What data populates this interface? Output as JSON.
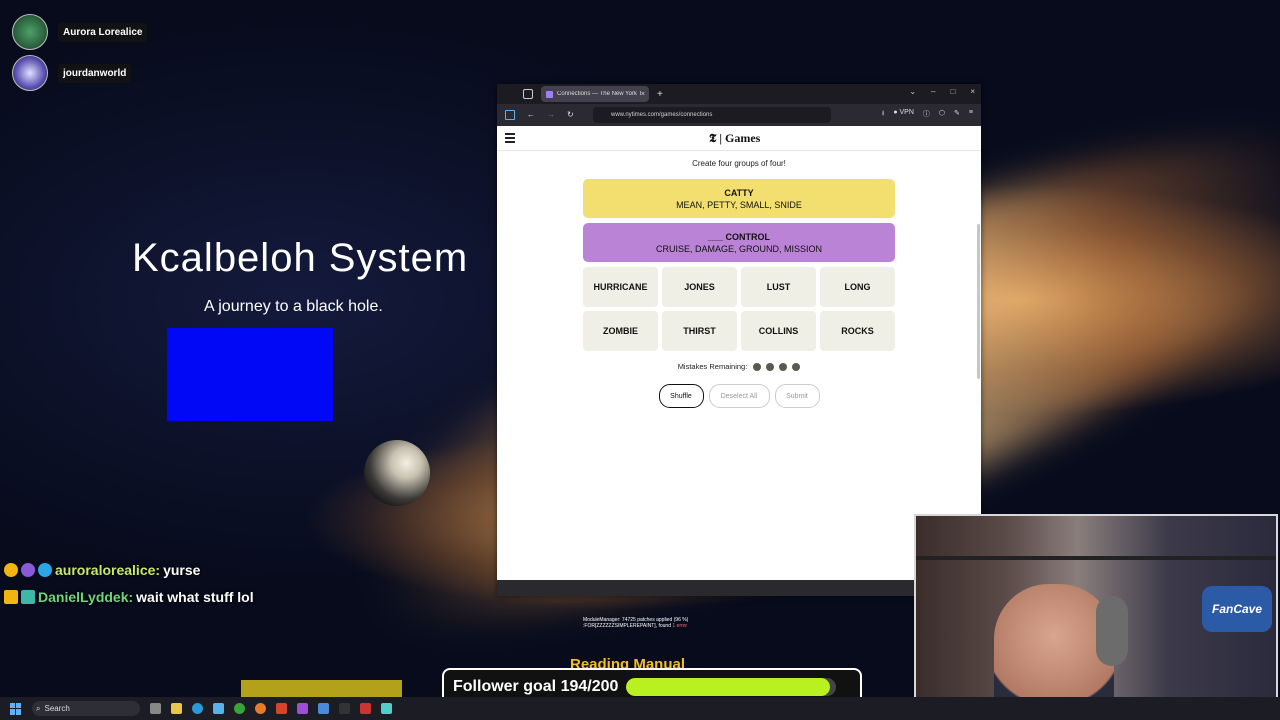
{
  "overlay": {
    "viewers": [
      {
        "name": "Aurora Lorealice",
        "color": "#2f7a48"
      },
      {
        "name": "jourdanworld",
        "color": "#5a4fb0"
      }
    ],
    "game_title": "Kcalbeloh System",
    "game_subtitle": "A journey to a black hole.",
    "chat": [
      {
        "user": "auroralorealice:",
        "message": "yurse"
      },
      {
        "user": "DanielLyddek:",
        "message": "wait what stuff lol"
      }
    ],
    "mod_manager_line1": "ModuleManager: 74725 patches applied (96 %)",
    "mod_manager_line2": ":FOR[ZZZZZZSIMPLEREPAINT], found",
    "mod_manager_error": "1 error",
    "reading_manual": "Reading Manual",
    "follower_goal": {
      "label": "Follower goal 194/200",
      "current": 194,
      "target": 200
    },
    "webcam_logo": "FanCave"
  },
  "browser": {
    "tab_title": "Connections — The New York Times",
    "tab_close": "×",
    "new_tab": "+",
    "window_controls": {
      "dropdown": "⌄",
      "minimize": "–",
      "maximize": "□",
      "close": "×"
    },
    "nav": {
      "back": "←",
      "forward": "→",
      "reload": "↻"
    },
    "url": "www.nytimes.com/games/connections",
    "vpn_label": "VPN"
  },
  "page": {
    "brand": "Games",
    "instruction": "Create four groups of four!",
    "solved_groups": [
      {
        "category": "CATTY",
        "members": "MEAN, PETTY, SMALL, SNIDE",
        "color": "#f2df6f"
      },
      {
        "category": "___ CONTROL",
        "members": "CRUISE, DAMAGE, GROUND, MISSION",
        "color": "#bb83d6"
      }
    ],
    "tiles": [
      "HURRICANE",
      "JONES",
      "LUST",
      "LONG",
      "ZOMBIE",
      "THIRST",
      "COLLINS",
      "ROCKS"
    ],
    "mistakes_label": "Mistakes Remaining:",
    "mistakes_remaining": 4,
    "buttons": {
      "shuffle": "Shuffle",
      "deselect": "Deselect All",
      "submit": "Submit"
    }
  },
  "taskbar": {
    "search_placeholder": "Search"
  }
}
